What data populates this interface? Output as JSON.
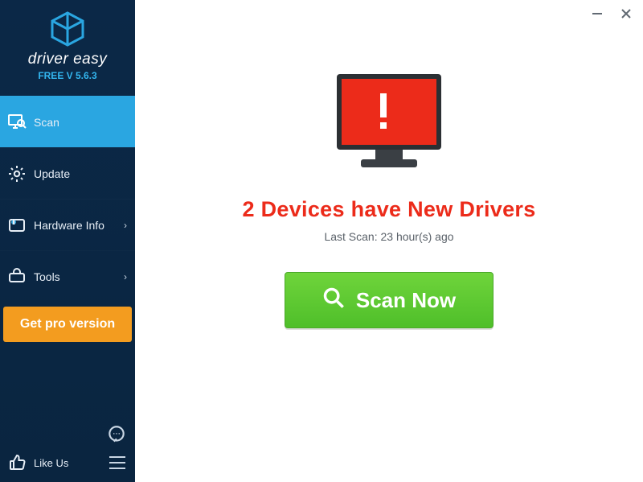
{
  "brand": {
    "name": "driver easy",
    "version": "FREE V 5.6.3"
  },
  "sidebar": {
    "items": [
      {
        "label": "Scan",
        "active": true,
        "expandable": false
      },
      {
        "label": "Update",
        "active": false,
        "expandable": false
      },
      {
        "label": "Hardware Info",
        "active": false,
        "expandable": true
      },
      {
        "label": "Tools",
        "active": false,
        "expandable": true
      }
    ],
    "pro_button": "Get pro version",
    "like_us": "Like Us"
  },
  "titlebar": {
    "minimize": "minimize",
    "close": "close"
  },
  "main": {
    "headline": "2 Devices have New Drivers",
    "last_scan": "Last Scan: 23 hour(s) ago",
    "scan_button": "Scan Now"
  },
  "colors": {
    "accent": "#2aa6e1",
    "warn": "#ec2b1a",
    "pro": "#f39c1f",
    "green": "#5ec92f"
  }
}
